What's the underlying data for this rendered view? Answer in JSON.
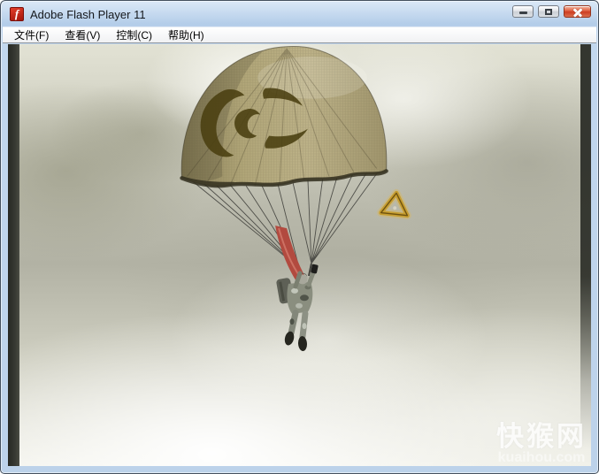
{
  "window": {
    "title": "Adobe Flash Player 11",
    "icons": {
      "app": "flash-icon",
      "minimize": "minimize-icon",
      "maximize": "maximize-icon",
      "close": "close-icon"
    },
    "colors": {
      "titlebar": "#bcd2ea",
      "close_button": "#ce3d21"
    }
  },
  "menu": {
    "items": [
      {
        "label": "文件(F)"
      },
      {
        "label": "查看(V)"
      },
      {
        "label": "控制(C)"
      },
      {
        "label": "帮助(H)"
      }
    ]
  },
  "game": {
    "scene": "paratrooper descending through cloudy sky",
    "elements": {
      "parachute_canopy": {
        "color": "#b2a679",
        "logo_color": "#4a3f10"
      },
      "red_streamer": {
        "color": "#b24a3f"
      },
      "triangle_pickup": {
        "color": "#c79e30"
      },
      "sky": {
        "cloud_base": "#c0c0b2",
        "cloud_bright": "#f4f4ee",
        "cloud_dark": "#8a8a72"
      }
    }
  },
  "watermark": {
    "site_name": "快猴网",
    "site_domain": "kuaihou.com"
  }
}
